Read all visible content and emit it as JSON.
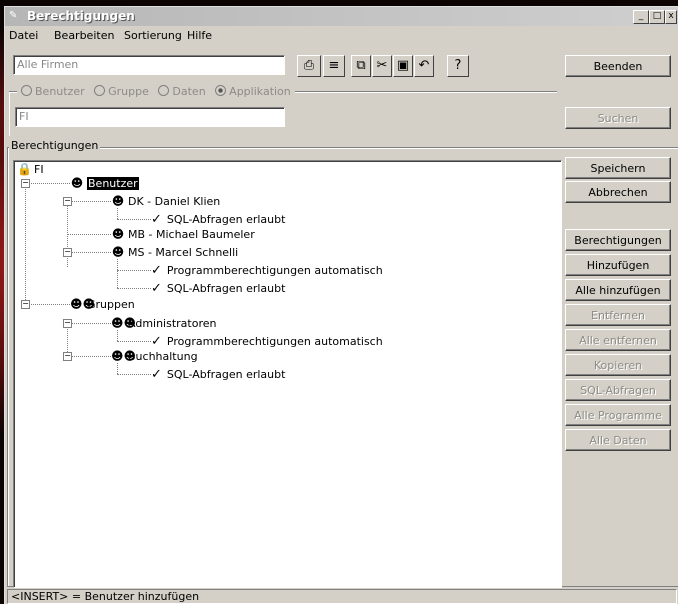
{
  "window": {
    "title": "Berechtigungen"
  },
  "titlebar_buttons": {
    "minimize": "_",
    "maximize": "□",
    "close": "x"
  },
  "menu": [
    "Datei",
    "Bearbeiten",
    "Sortierung",
    "Hilfe"
  ],
  "toolbar": {
    "company_field": "Alle Firmen",
    "tools": [
      "printer-icon",
      "list-icon",
      "copy-icon",
      "cut-icon",
      "paste-icon",
      "undo-icon",
      "help-icon"
    ],
    "beenden": "Beenden"
  },
  "filter": {
    "radios": [
      {
        "label": "Benutzer",
        "checked": false
      },
      {
        "label": "Gruppe",
        "checked": false
      },
      {
        "label": "Daten",
        "checked": false
      },
      {
        "label": "Applikation",
        "checked": true
      }
    ],
    "input": "FI",
    "suchen": "Suchen"
  },
  "group_label": "Berechtigungen",
  "tree": [
    {
      "label": "FI"
    },
    {
      "label": "Benutzer"
    },
    {
      "label": "DK - Daniel Klien"
    },
    {
      "label": "SQL-Abfragen erlaubt"
    },
    {
      "label": "MB - Michael Baumeler"
    },
    {
      "label": "MS - Marcel Schnelli"
    },
    {
      "label": "Programmberechtigungen automatisch"
    },
    {
      "label": "SQL-Abfragen erlaubt"
    },
    {
      "label": "Gruppen"
    },
    {
      "label": "Administratoren"
    },
    {
      "label": "Programmberechtigungen automatisch"
    },
    {
      "label": "Buchhaltung"
    },
    {
      "label": "SQL-Abfragen erlaubt"
    }
  ],
  "side_buttons": [
    {
      "label": "Speichern",
      "enabled": true
    },
    {
      "label": "Abbrechen",
      "enabled": true
    },
    {
      "label": "Berechtigungen",
      "enabled": true
    },
    {
      "label": "Hinzufügen",
      "enabled": true
    },
    {
      "label": "Alle hinzufügen",
      "enabled": true
    },
    {
      "label": "Entfernen",
      "enabled": false
    },
    {
      "label": "Alle entfernen",
      "enabled": false
    },
    {
      "label": "Kopieren",
      "enabled": false
    },
    {
      "label": "SQL-Abfragen",
      "enabled": false
    },
    {
      "label": "Alle Programme",
      "enabled": false
    },
    {
      "label": "Alle Daten",
      "enabled": false
    }
  ],
  "status": "<INSERT> = Benutzer hinzufügen"
}
